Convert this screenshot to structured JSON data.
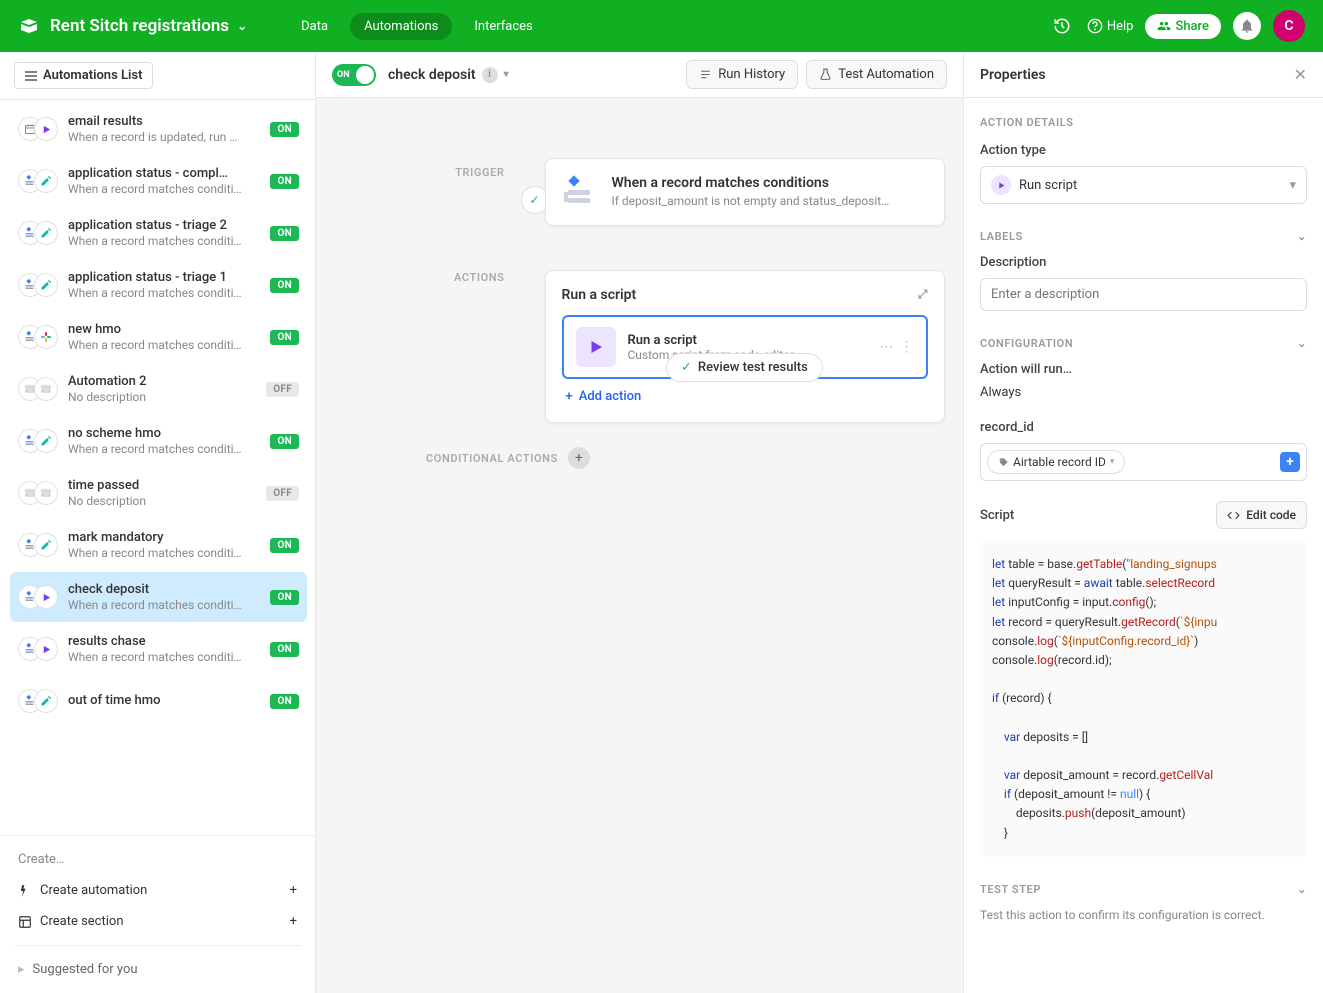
{
  "header": {
    "title": "Rent Sitch registrations",
    "nav": {
      "data": "Data",
      "automations": "Automations",
      "interfaces": "Interfaces"
    },
    "help": "Help",
    "share": "Share",
    "avatar": "C"
  },
  "sidebar": {
    "header_label": "Automations List",
    "create": "Create…",
    "create_automation": "Create automation",
    "create_section": "Create section",
    "suggested": "Suggested for you",
    "items": [
      {
        "title": "email results",
        "sub": "When a record is updated, run …",
        "status": "ON",
        "icons": "cal-play"
      },
      {
        "title": "application status - compl…",
        "sub": "When a record matches conditi…",
        "status": "ON",
        "icons": "match-edit"
      },
      {
        "title": "application status - triage 2",
        "sub": "When a record matches conditi…",
        "status": "ON",
        "icons": "match-edit"
      },
      {
        "title": "application status - triage 1",
        "sub": "When a record matches conditi…",
        "status": "ON",
        "icons": "match-edit"
      },
      {
        "title": "new hmo",
        "sub": "When a record matches conditi…",
        "status": "ON",
        "icons": "match-slack"
      },
      {
        "title": "Automation 2",
        "sub": "No description",
        "status": "OFF",
        "icons": "grey-grey"
      },
      {
        "title": "no scheme hmo",
        "sub": "When a record matches conditi…",
        "status": "ON",
        "icons": "match-edit"
      },
      {
        "title": "time passed",
        "sub": "No description",
        "status": "OFF",
        "icons": "grey-grey"
      },
      {
        "title": "mark mandatory",
        "sub": "When a record matches conditi…",
        "status": "ON",
        "icons": "match-edit"
      },
      {
        "title": "check deposit",
        "sub": "When a record matches conditi…",
        "status": "ON",
        "icons": "match-play",
        "selected": true
      },
      {
        "title": "results chase",
        "sub": "When a record matches conditi…",
        "status": "ON",
        "icons": "match-play"
      },
      {
        "title": "out of time hmo",
        "sub": "",
        "status": "ON",
        "icons": "match-edit"
      }
    ]
  },
  "canvas": {
    "toggle": "ON",
    "automation_name": "check deposit",
    "run_history": "Run History",
    "test_automation": "Test Automation",
    "trigger_label": "TRIGGER",
    "actions_label": "ACTIONS",
    "conditional_label": "CONDITIONAL ACTIONS",
    "review": "Review test results",
    "trigger_card": {
      "title": "When a record matches conditions",
      "sub": "If deposit_amount is not empty and status_deposit…"
    },
    "actions_card": {
      "group_title": "Run a script",
      "step_title": "Run a script",
      "step_sub": "Custom script from code editor",
      "add": "Add action"
    }
  },
  "props": {
    "title": "Properties",
    "action_details": "ACTION DETAILS",
    "action_type": "Action type",
    "action_type_value": "Run script",
    "labels": "LABELS",
    "description": "Description",
    "description_placeholder": "Enter a description",
    "configuration": "CONFIGURATION",
    "action_will_run": "Action will run…",
    "always": "Always",
    "record_id": "record_id",
    "record_id_chip": "Airtable record ID",
    "script": "Script",
    "edit_code": "Edit code",
    "test_step": "TEST STEP",
    "test_desc": "Test this action to confirm its configuration is correct.",
    "code_lines": {
      "l1a": "let",
      "l1b": " table = base.",
      "l1c": "getTable",
      "l1d": "(",
      "l1e": "\"landing_signups",
      "l1f": "",
      "l2a": "let",
      "l2b": " queryResult = ",
      "l2c": "await",
      "l2d": " table.",
      "l2e": "selectRecord",
      "l2f": "",
      "l3a": "let",
      "l3b": " inputConfig = input.",
      "l3c": "config",
      "l3d": "();",
      "l4a": "let",
      "l4b": " record = queryResult.",
      "l4c": "getRecord",
      "l4d": "(",
      "l4e": "`${inpu",
      "l4f": "",
      "l5a": "console.",
      "l5b": "log",
      "l5c": "(",
      "l5d": "`${inputConfig.record_id}`",
      "l5e": ")",
      "l6a": "console.",
      "l6b": "log",
      "l6c": "(record.id);",
      "l7a": "if",
      "l7b": " (record) {",
      "l8a": "    var",
      "l8b": " deposits = []",
      "l9a": "    var",
      "l9b": " deposit_amount = record.",
      "l9c": "getCellVal",
      "l9d": "",
      "l10a": "    if",
      "l10b": " (deposit_amount != ",
      "l10c": "null",
      "l10d": ") {",
      "l11a": "        deposits.",
      "l11b": "push",
      "l11c": "(deposit_amount)",
      "l12": "    }"
    }
  }
}
